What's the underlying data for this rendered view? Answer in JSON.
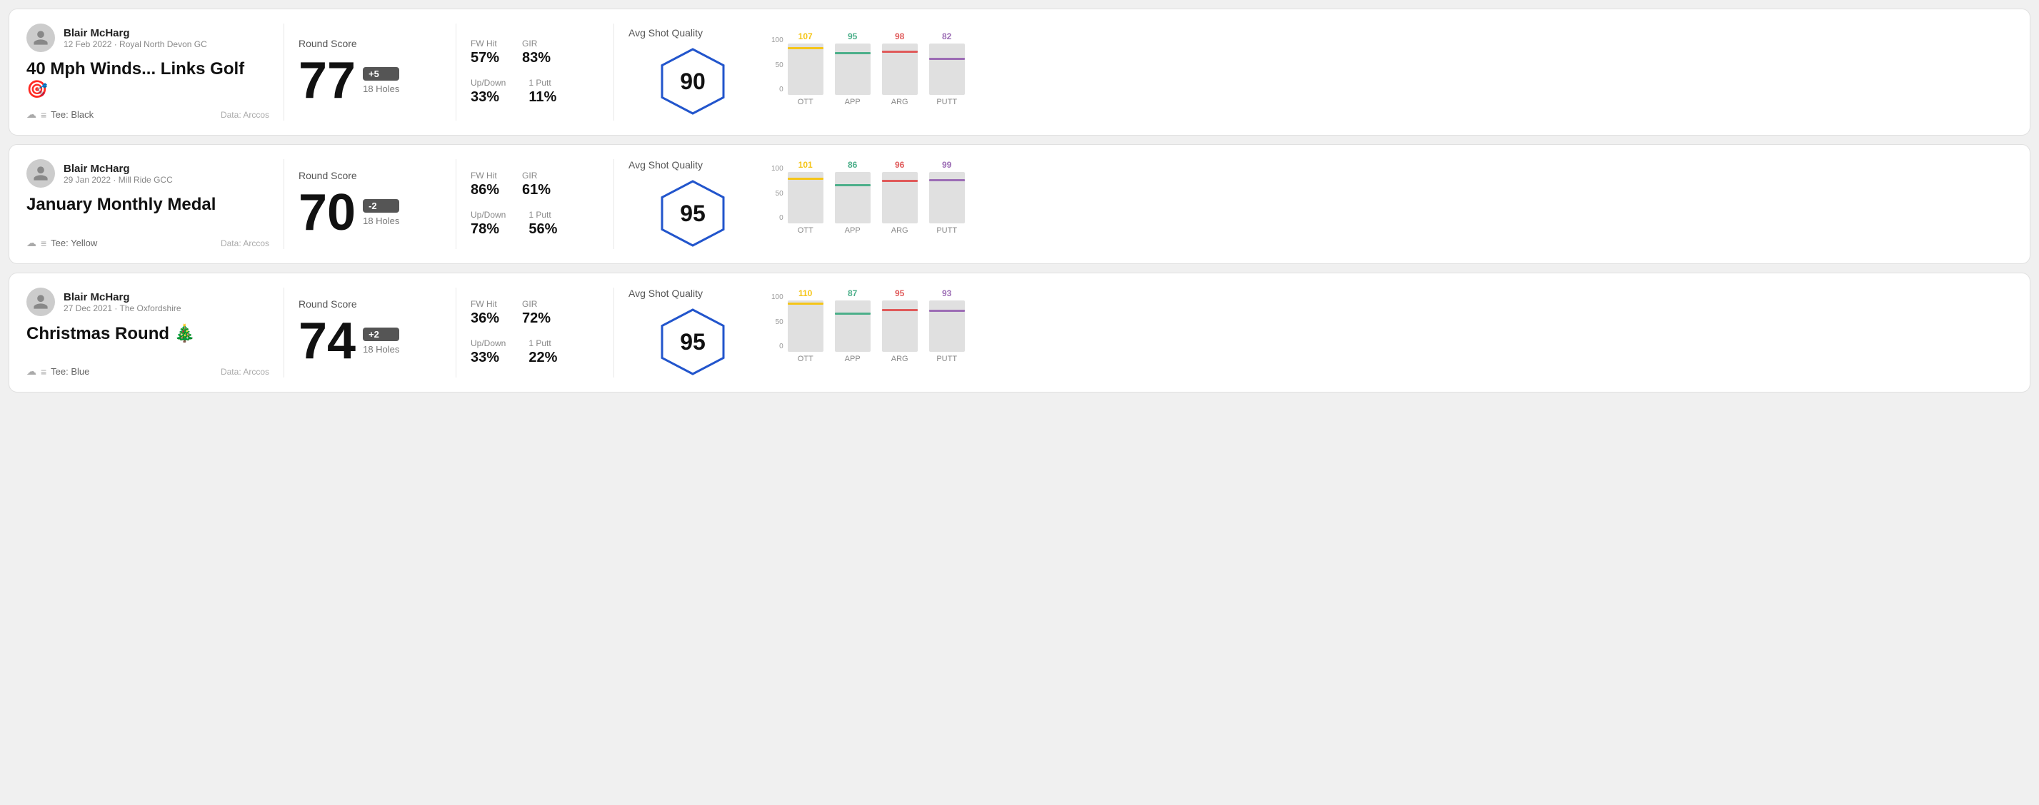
{
  "rounds": [
    {
      "id": "round-1",
      "user": {
        "name": "Blair McHarg",
        "date": "12 Feb 2022 · Royal North Devon GC"
      },
      "title": "40 Mph Winds... Links Golf 🎯",
      "tee": "Black",
      "dataSource": "Data: Arccos",
      "score": {
        "label": "Round Score",
        "number": "77",
        "modifier": "+5",
        "holes": "18 Holes"
      },
      "stats": {
        "fwHit": {
          "label": "FW Hit",
          "value": "57%"
        },
        "gir": {
          "label": "GIR",
          "value": "83%"
        },
        "upDown": {
          "label": "Up/Down",
          "value": "33%"
        },
        "onePutt": {
          "label": "1 Putt",
          "value": "11%"
        }
      },
      "quality": {
        "label": "Avg Shot Quality",
        "value": "90"
      },
      "chart": {
        "bars": [
          {
            "label": "OTT",
            "value": 107,
            "color": "#f5c518"
          },
          {
            "label": "APP",
            "value": 95,
            "color": "#4caf8a"
          },
          {
            "label": "ARG",
            "value": 98,
            "color": "#e05a5a"
          },
          {
            "label": "PUTT",
            "value": 82,
            "color": "#9c6db5"
          }
        ]
      }
    },
    {
      "id": "round-2",
      "user": {
        "name": "Blair McHarg",
        "date": "29 Jan 2022 · Mill Ride GCC"
      },
      "title": "January Monthly Medal",
      "tee": "Yellow",
      "dataSource": "Data: Arccos",
      "score": {
        "label": "Round Score",
        "number": "70",
        "modifier": "-2",
        "holes": "18 Holes"
      },
      "stats": {
        "fwHit": {
          "label": "FW Hit",
          "value": "86%"
        },
        "gir": {
          "label": "GIR",
          "value": "61%"
        },
        "upDown": {
          "label": "Up/Down",
          "value": "78%"
        },
        "onePutt": {
          "label": "1 Putt",
          "value": "56%"
        }
      },
      "quality": {
        "label": "Avg Shot Quality",
        "value": "95"
      },
      "chart": {
        "bars": [
          {
            "label": "OTT",
            "value": 101,
            "color": "#f5c518"
          },
          {
            "label": "APP",
            "value": 86,
            "color": "#4caf8a"
          },
          {
            "label": "ARG",
            "value": 96,
            "color": "#e05a5a"
          },
          {
            "label": "PUTT",
            "value": 99,
            "color": "#9c6db5"
          }
        ]
      }
    },
    {
      "id": "round-3",
      "user": {
        "name": "Blair McHarg",
        "date": "27 Dec 2021 · The Oxfordshire"
      },
      "title": "Christmas Round 🎄",
      "tee": "Blue",
      "dataSource": "Data: Arccos",
      "score": {
        "label": "Round Score",
        "number": "74",
        "modifier": "+2",
        "holes": "18 Holes"
      },
      "stats": {
        "fwHit": {
          "label": "FW Hit",
          "value": "36%"
        },
        "gir": {
          "label": "GIR",
          "value": "72%"
        },
        "upDown": {
          "label": "Up/Down",
          "value": "33%"
        },
        "onePutt": {
          "label": "1 Putt",
          "value": "22%"
        }
      },
      "quality": {
        "label": "Avg Shot Quality",
        "value": "95"
      },
      "chart": {
        "bars": [
          {
            "label": "OTT",
            "value": 110,
            "color": "#f5c518"
          },
          {
            "label": "APP",
            "value": 87,
            "color": "#4caf8a"
          },
          {
            "label": "ARG",
            "value": 95,
            "color": "#e05a5a"
          },
          {
            "label": "PUTT",
            "value": 93,
            "color": "#9c6db5"
          }
        ]
      }
    }
  ],
  "ui": {
    "tee_label": "Tee:",
    "y_axis": [
      "100",
      "50",
      "0"
    ]
  }
}
